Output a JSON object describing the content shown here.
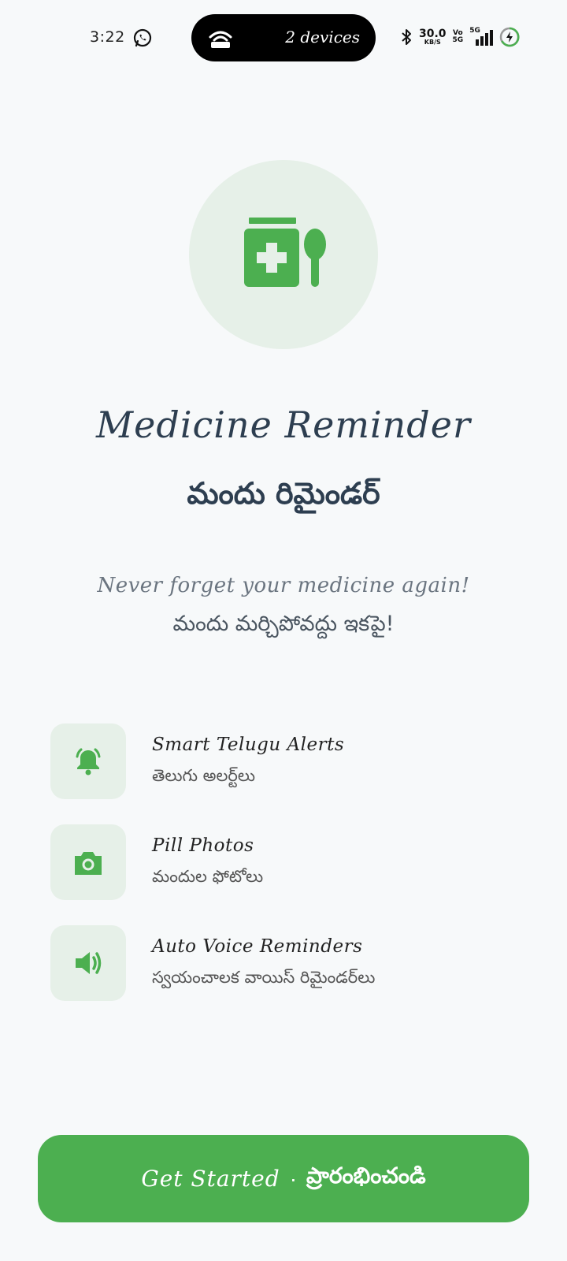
{
  "status_bar": {
    "time": "3:22",
    "hotspot_text": "2 devices",
    "net_speed": "30.0",
    "net_speed_unit": "KB/S",
    "volte_top": "Vo",
    "volte_bottom": "5G",
    "network_label": "5G"
  },
  "app": {
    "title_en": "Medicine Reminder",
    "title_te": "మందు రిమైండర్",
    "subtitle_en": "Never forget your medicine again!",
    "subtitle_te": "మందు మర్చిపోవద్దు ఇకపై!"
  },
  "features": [
    {
      "icon": "bell-icon",
      "title": "Smart Telugu Alerts",
      "subtitle": "తెలుగు అలర్ట్‌లు"
    },
    {
      "icon": "camera-icon",
      "title": "Pill Photos",
      "subtitle": "మందుల ఫోటోలు"
    },
    {
      "icon": "speaker-icon",
      "title": "Auto Voice Reminders",
      "subtitle": "స్వయంచాలక వాయిస్ రిమైండర్‌లు"
    }
  ],
  "cta": {
    "label_en": "Get Started",
    "separator": "·",
    "label_te": "ప్రారంభించండి"
  },
  "colors": {
    "accent": "#4caf50",
    "tile_bg": "#e6f0e8",
    "title_text": "#2d3e50",
    "background": "#f7f9fa"
  }
}
